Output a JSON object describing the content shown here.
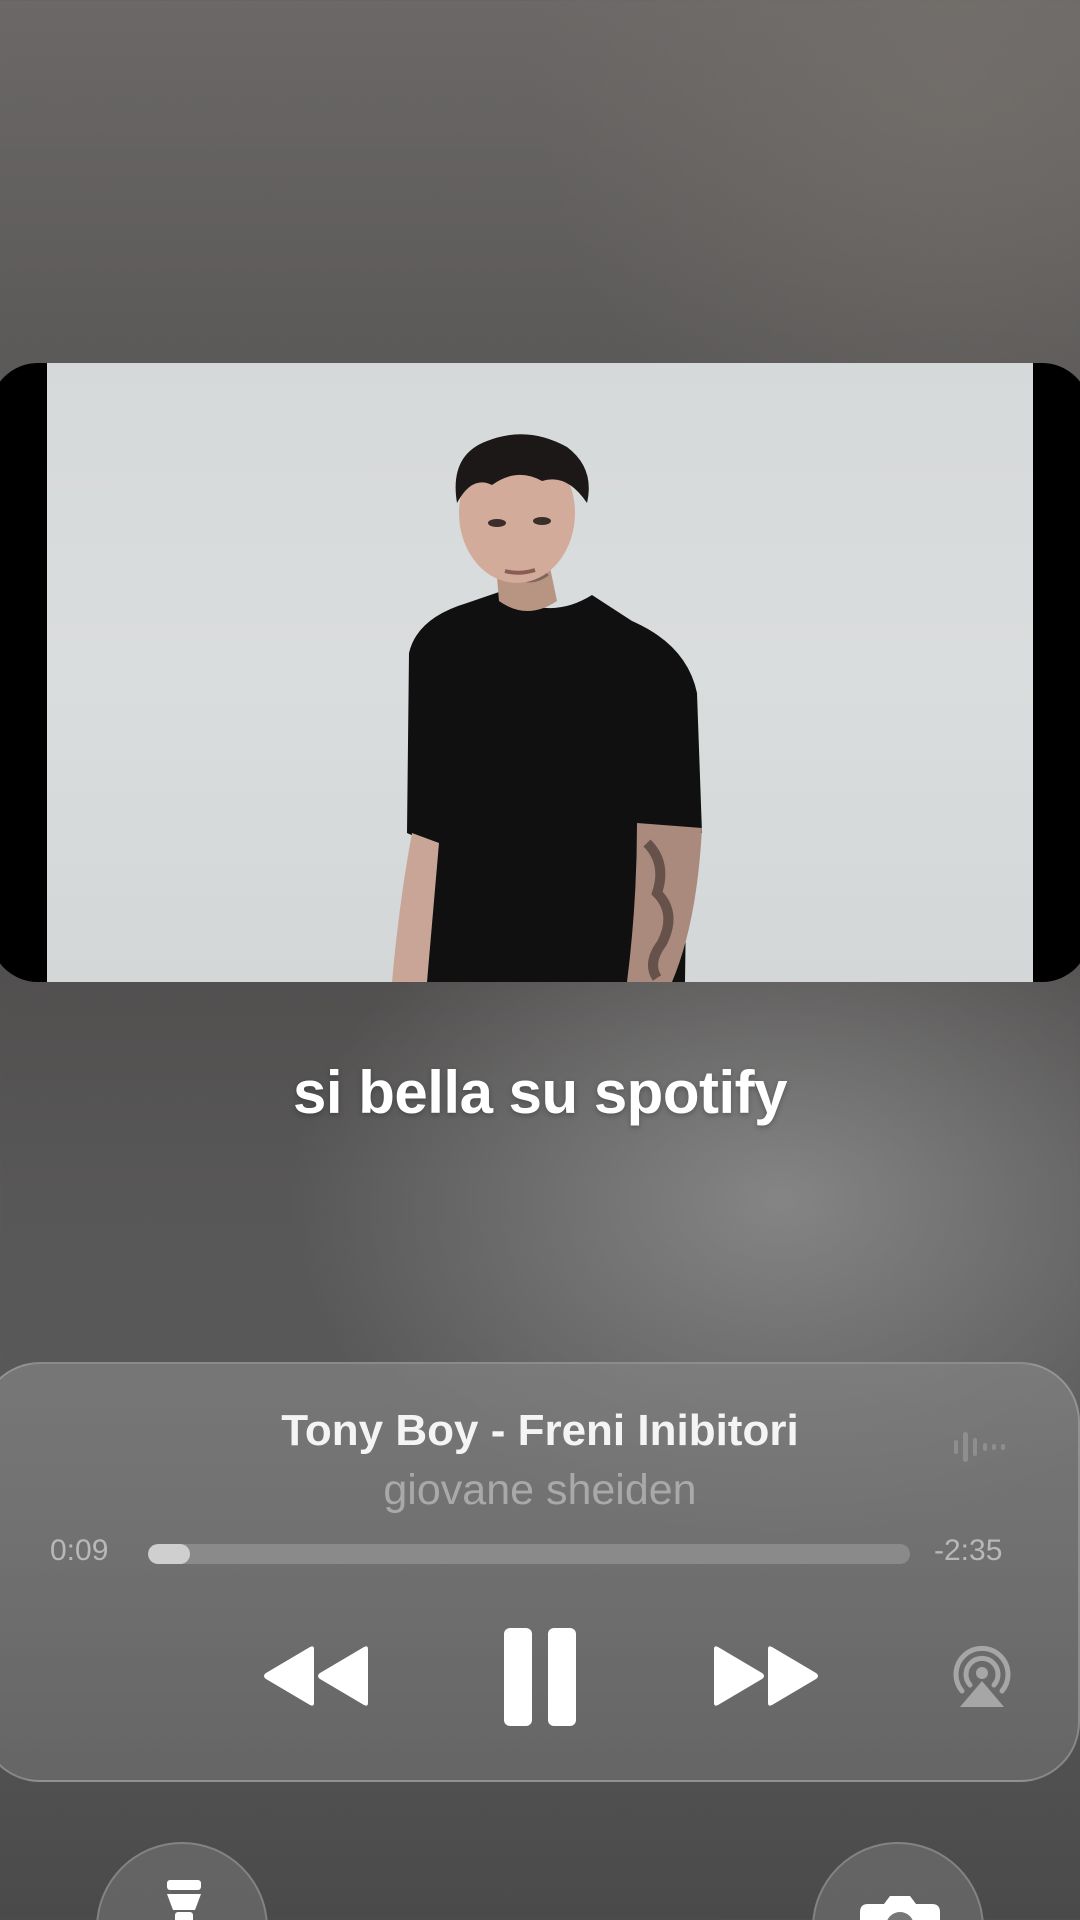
{
  "caption": "si bella su spotify",
  "now_playing": {
    "title": "Tony Boy - Freni Inibitori",
    "artist": "giovane sheiden",
    "elapsed": "0:09",
    "remaining": "-2:35",
    "progress_fraction": 0.055,
    "controls": {
      "rewind_icon": "rewind-icon",
      "pause_icon": "pause-icon",
      "forward_icon": "fast-forward-icon",
      "airplay_icon": "airplay-audio-icon",
      "waveform_icon": "waveform-icon"
    }
  },
  "lockscreen_buttons": {
    "left_icon": "flashlight-icon",
    "right_icon": "camera-icon"
  },
  "colors": {
    "text_primary": "#f4f4f4",
    "text_secondary": "#a9a9a9",
    "progress_fill": "#cfcfcf"
  }
}
